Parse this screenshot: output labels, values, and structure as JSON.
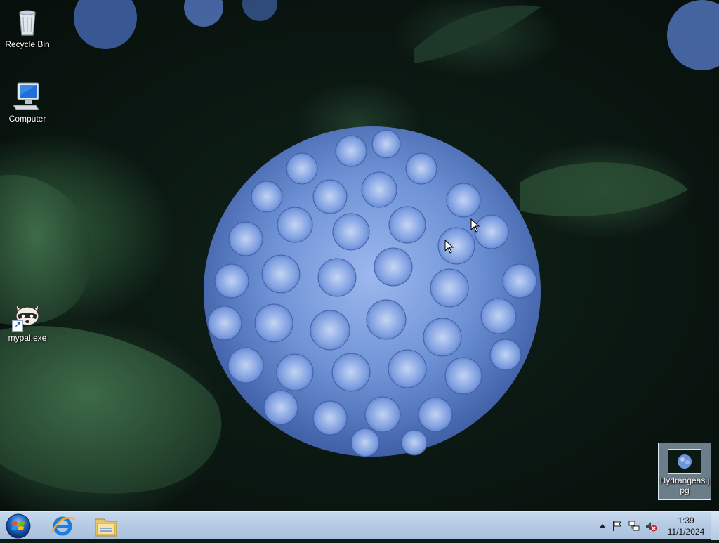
{
  "desktop": {
    "icons": [
      {
        "label": "Recycle Bin",
        "icon": "recycle-bin-icon"
      },
      {
        "label": "Computer",
        "icon": "computer-icon"
      },
      {
        "label": "mypal.exe",
        "icon": "mypal-raccoon-icon"
      },
      {
        "label": "Hydrangeas.jpg",
        "icon": "image-file-icon",
        "selected": true
      }
    ]
  },
  "taskbar": {
    "start_icon": "windows-start-orb-icon",
    "pinned": [
      {
        "name": "Internet Explorer",
        "icon": "internet-explorer-icon"
      },
      {
        "name": "Windows Explorer",
        "icon": "file-explorer-folder-icon"
      }
    ],
    "tray": {
      "icons": [
        "show-hidden-icons-icon",
        "action-center-flag-icon",
        "network-icon",
        "volume-muted-icon"
      ],
      "time": "1:39",
      "date": "11/1/2024"
    }
  },
  "colors": {
    "taskbar": "#b6cbe4",
    "selection": "#bed7f0",
    "hydrangea": "#6f93d6"
  }
}
